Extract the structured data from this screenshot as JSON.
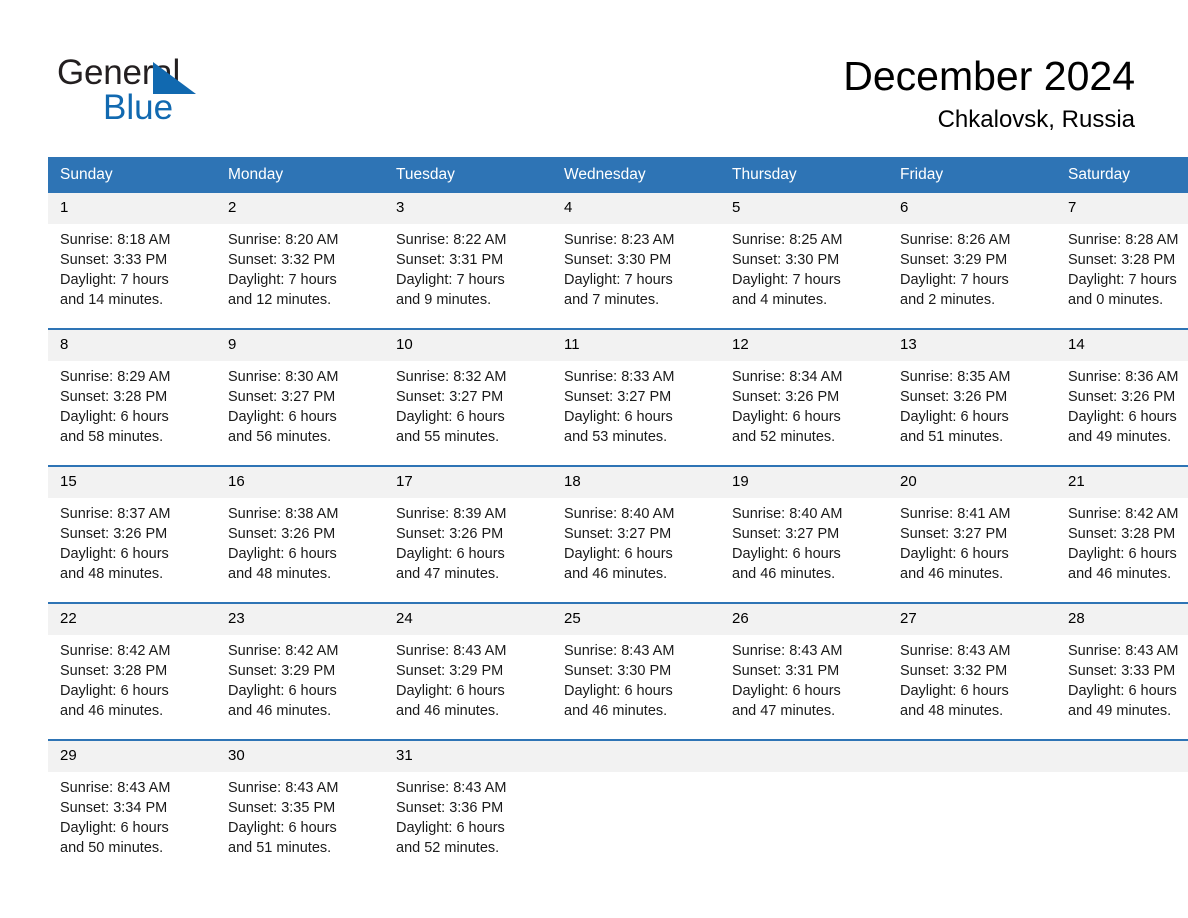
{
  "logo": {
    "line1": "General",
    "line2": "Blue",
    "triangle_color": "#1169b0"
  },
  "header": {
    "title": "December 2024",
    "location": "Chkalovsk, Russia"
  },
  "colors": {
    "header_blue": "#2e74b5",
    "daynum_background": "#f2f2f2",
    "row_divider": "#2e74b5"
  },
  "calendar": {
    "weekday_headers": [
      "Sunday",
      "Monday",
      "Tuesday",
      "Wednesday",
      "Thursday",
      "Friday",
      "Saturday"
    ],
    "weeks": [
      [
        {
          "day": "1",
          "sunrise": "Sunrise: 8:18 AM",
          "sunset": "Sunset: 3:33 PM",
          "daylight_line1": "Daylight: 7 hours",
          "daylight_line2": "and 14 minutes."
        },
        {
          "day": "2",
          "sunrise": "Sunrise: 8:20 AM",
          "sunset": "Sunset: 3:32 PM",
          "daylight_line1": "Daylight: 7 hours",
          "daylight_line2": "and 12 minutes."
        },
        {
          "day": "3",
          "sunrise": "Sunrise: 8:22 AM",
          "sunset": "Sunset: 3:31 PM",
          "daylight_line1": "Daylight: 7 hours",
          "daylight_line2": "and 9 minutes."
        },
        {
          "day": "4",
          "sunrise": "Sunrise: 8:23 AM",
          "sunset": "Sunset: 3:30 PM",
          "daylight_line1": "Daylight: 7 hours",
          "daylight_line2": "and 7 minutes."
        },
        {
          "day": "5",
          "sunrise": "Sunrise: 8:25 AM",
          "sunset": "Sunset: 3:30 PM",
          "daylight_line1": "Daylight: 7 hours",
          "daylight_line2": "and 4 minutes."
        },
        {
          "day": "6",
          "sunrise": "Sunrise: 8:26 AM",
          "sunset": "Sunset: 3:29 PM",
          "daylight_line1": "Daylight: 7 hours",
          "daylight_line2": "and 2 minutes."
        },
        {
          "day": "7",
          "sunrise": "Sunrise: 8:28 AM",
          "sunset": "Sunset: 3:28 PM",
          "daylight_line1": "Daylight: 7 hours",
          "daylight_line2": "and 0 minutes."
        }
      ],
      [
        {
          "day": "8",
          "sunrise": "Sunrise: 8:29 AM",
          "sunset": "Sunset: 3:28 PM",
          "daylight_line1": "Daylight: 6 hours",
          "daylight_line2": "and 58 minutes."
        },
        {
          "day": "9",
          "sunrise": "Sunrise: 8:30 AM",
          "sunset": "Sunset: 3:27 PM",
          "daylight_line1": "Daylight: 6 hours",
          "daylight_line2": "and 56 minutes."
        },
        {
          "day": "10",
          "sunrise": "Sunrise: 8:32 AM",
          "sunset": "Sunset: 3:27 PM",
          "daylight_line1": "Daylight: 6 hours",
          "daylight_line2": "and 55 minutes."
        },
        {
          "day": "11",
          "sunrise": "Sunrise: 8:33 AM",
          "sunset": "Sunset: 3:27 PM",
          "daylight_line1": "Daylight: 6 hours",
          "daylight_line2": "and 53 minutes."
        },
        {
          "day": "12",
          "sunrise": "Sunrise: 8:34 AM",
          "sunset": "Sunset: 3:26 PM",
          "daylight_line1": "Daylight: 6 hours",
          "daylight_line2": "and 52 minutes."
        },
        {
          "day": "13",
          "sunrise": "Sunrise: 8:35 AM",
          "sunset": "Sunset: 3:26 PM",
          "daylight_line1": "Daylight: 6 hours",
          "daylight_line2": "and 51 minutes."
        },
        {
          "day": "14",
          "sunrise": "Sunrise: 8:36 AM",
          "sunset": "Sunset: 3:26 PM",
          "daylight_line1": "Daylight: 6 hours",
          "daylight_line2": "and 49 minutes."
        }
      ],
      [
        {
          "day": "15",
          "sunrise": "Sunrise: 8:37 AM",
          "sunset": "Sunset: 3:26 PM",
          "daylight_line1": "Daylight: 6 hours",
          "daylight_line2": "and 48 minutes."
        },
        {
          "day": "16",
          "sunrise": "Sunrise: 8:38 AM",
          "sunset": "Sunset: 3:26 PM",
          "daylight_line1": "Daylight: 6 hours",
          "daylight_line2": "and 48 minutes."
        },
        {
          "day": "17",
          "sunrise": "Sunrise: 8:39 AM",
          "sunset": "Sunset: 3:26 PM",
          "daylight_line1": "Daylight: 6 hours",
          "daylight_line2": "and 47 minutes."
        },
        {
          "day": "18",
          "sunrise": "Sunrise: 8:40 AM",
          "sunset": "Sunset: 3:27 PM",
          "daylight_line1": "Daylight: 6 hours",
          "daylight_line2": "and 46 minutes."
        },
        {
          "day": "19",
          "sunrise": "Sunrise: 8:40 AM",
          "sunset": "Sunset: 3:27 PM",
          "daylight_line1": "Daylight: 6 hours",
          "daylight_line2": "and 46 minutes."
        },
        {
          "day": "20",
          "sunrise": "Sunrise: 8:41 AM",
          "sunset": "Sunset: 3:27 PM",
          "daylight_line1": "Daylight: 6 hours",
          "daylight_line2": "and 46 minutes."
        },
        {
          "day": "21",
          "sunrise": "Sunrise: 8:42 AM",
          "sunset": "Sunset: 3:28 PM",
          "daylight_line1": "Daylight: 6 hours",
          "daylight_line2": "and 46 minutes."
        }
      ],
      [
        {
          "day": "22",
          "sunrise": "Sunrise: 8:42 AM",
          "sunset": "Sunset: 3:28 PM",
          "daylight_line1": "Daylight: 6 hours",
          "daylight_line2": "and 46 minutes."
        },
        {
          "day": "23",
          "sunrise": "Sunrise: 8:42 AM",
          "sunset": "Sunset: 3:29 PM",
          "daylight_line1": "Daylight: 6 hours",
          "daylight_line2": "and 46 minutes."
        },
        {
          "day": "24",
          "sunrise": "Sunrise: 8:43 AM",
          "sunset": "Sunset: 3:29 PM",
          "daylight_line1": "Daylight: 6 hours",
          "daylight_line2": "and 46 minutes."
        },
        {
          "day": "25",
          "sunrise": "Sunrise: 8:43 AM",
          "sunset": "Sunset: 3:30 PM",
          "daylight_line1": "Daylight: 6 hours",
          "daylight_line2": "and 46 minutes."
        },
        {
          "day": "26",
          "sunrise": "Sunrise: 8:43 AM",
          "sunset": "Sunset: 3:31 PM",
          "daylight_line1": "Daylight: 6 hours",
          "daylight_line2": "and 47 minutes."
        },
        {
          "day": "27",
          "sunrise": "Sunrise: 8:43 AM",
          "sunset": "Sunset: 3:32 PM",
          "daylight_line1": "Daylight: 6 hours",
          "daylight_line2": "and 48 minutes."
        },
        {
          "day": "28",
          "sunrise": "Sunrise: 8:43 AM",
          "sunset": "Sunset: 3:33 PM",
          "daylight_line1": "Daylight: 6 hours",
          "daylight_line2": "and 49 minutes."
        }
      ],
      [
        {
          "day": "29",
          "sunrise": "Sunrise: 8:43 AM",
          "sunset": "Sunset: 3:34 PM",
          "daylight_line1": "Daylight: 6 hours",
          "daylight_line2": "and 50 minutes."
        },
        {
          "day": "30",
          "sunrise": "Sunrise: 8:43 AM",
          "sunset": "Sunset: 3:35 PM",
          "daylight_line1": "Daylight: 6 hours",
          "daylight_line2": "and 51 minutes."
        },
        {
          "day": "31",
          "sunrise": "Sunrise: 8:43 AM",
          "sunset": "Sunset: 3:36 PM",
          "daylight_line1": "Daylight: 6 hours",
          "daylight_line2": "and 52 minutes."
        },
        {
          "day": "",
          "sunrise": "",
          "sunset": "",
          "daylight_line1": "",
          "daylight_line2": ""
        },
        {
          "day": "",
          "sunrise": "",
          "sunset": "",
          "daylight_line1": "",
          "daylight_line2": ""
        },
        {
          "day": "",
          "sunrise": "",
          "sunset": "",
          "daylight_line1": "",
          "daylight_line2": ""
        },
        {
          "day": "",
          "sunrise": "",
          "sunset": "",
          "daylight_line1": "",
          "daylight_line2": ""
        }
      ]
    ]
  }
}
